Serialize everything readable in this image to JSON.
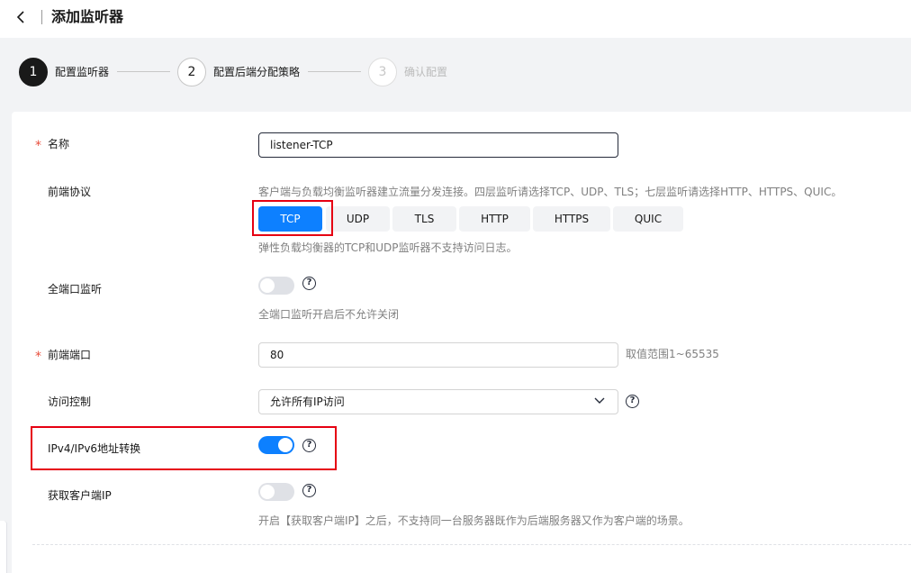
{
  "header": {
    "title": "添加监听器"
  },
  "steps": [
    {
      "number": "1",
      "label": "配置监听器"
    },
    {
      "number": "2",
      "label": "配置后端分配策略"
    },
    {
      "number": "3",
      "label": "确认配置"
    }
  ],
  "form": {
    "name": {
      "label": "名称",
      "value": "listener-TCP",
      "required": "*"
    },
    "protocol": {
      "label": "前端协议",
      "hint": "客户端与负载均衡监听器建立流量分发连接。四层监听请选择TCP、UDP、TLS；七层监听请选择HTTP、HTTPS、QUIC。",
      "options": [
        "TCP",
        "UDP",
        "TLS",
        "HTTP",
        "HTTPS",
        "QUIC"
      ],
      "selected": "TCP",
      "note": "弹性负载均衡器的TCP和UDP监听器不支持访问日志。"
    },
    "all_port": {
      "label": "全端口监听",
      "state": "off",
      "hint": "全端口监听开启后不允许关闭"
    },
    "port": {
      "label": "前端端口",
      "value": "80",
      "required": "*",
      "range_hint": "取值范围1~65535"
    },
    "access_control": {
      "label": "访问控制",
      "value": "允许所有IP访问"
    },
    "ipv6_convert": {
      "label": "IPv4/IPv6地址转换",
      "state": "on"
    },
    "client_ip": {
      "label": "获取客户端IP",
      "state": "off",
      "hint": "开启【获取客户端IP】之后，不支持同一台服务器既作为后端服务器又作为客户端的场景。"
    }
  },
  "icons": {
    "back": "chevron-left-icon",
    "help": "question-circle-icon",
    "dropdown": "chevron-down-icon"
  },
  "colors": {
    "accent": "#0d80ff",
    "required": "#e84f3d",
    "highlight": "#e60012"
  }
}
